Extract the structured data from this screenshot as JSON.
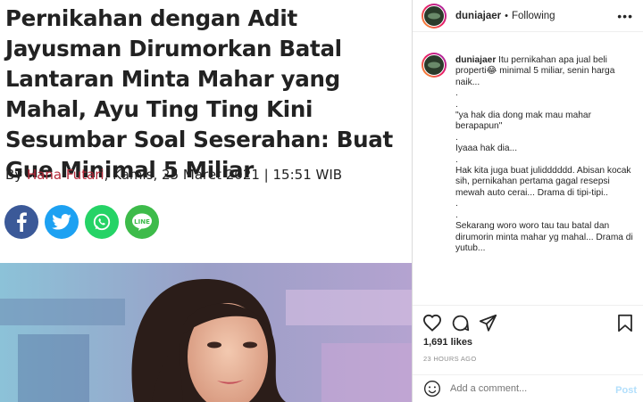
{
  "article": {
    "headline": "Pernikahan dengan Adit Jayusman Dirumorkan Batal Lantaran Minta Mahar yang Mahal, Ayu Ting Ting Kini Sesumbar Soal Seserahan: Buat Gue Minimal 5 Miliar",
    "byline_prefix": "By ",
    "author": "Hana Futari",
    "date_time": ", Kamis, 25 Maret 2021 | 15:51 WIB",
    "share": [
      {
        "icon": "facebook-icon",
        "color": "#3b5998"
      },
      {
        "icon": "twitter-icon",
        "color": "#1da1f2"
      },
      {
        "icon": "whatsapp-icon",
        "color": "#25d366"
      },
      {
        "icon": "line-icon",
        "color": "#3dbb4a",
        "label": "LINE"
      }
    ]
  },
  "post": {
    "username": "duniajaer",
    "separator": "•",
    "follow_status": "Following",
    "caption_user": "duniajaer",
    "caption": " Itu pernikahan apa jual beli properti😂 minimal 5 miliar, senin harga naik...\n.\n.\n\"ya hak dia dong mak mau mahar berapapun\"\n.\nIyaaa hak dia...\n.\nHak kita juga buat julidddddd. Abisan kocak sih, pernikahan pertama gagal resepsi mewah auto cerai... Drama di tipi-tipi..\n.\n.\nSekarang woro woro tau tau batal dan dirumorin minta mahar yg mahal... Drama di yutub...",
    "likes": "1,691 likes",
    "time_ago": "23 HOURS AGO",
    "comment_placeholder": "Add a comment...",
    "post_label": "Post"
  },
  "colors": {
    "author": "#b52a3a",
    "ig_text": "#262626",
    "ig_muted": "#8e8e8e",
    "post_disabled": "#b2dffc"
  }
}
